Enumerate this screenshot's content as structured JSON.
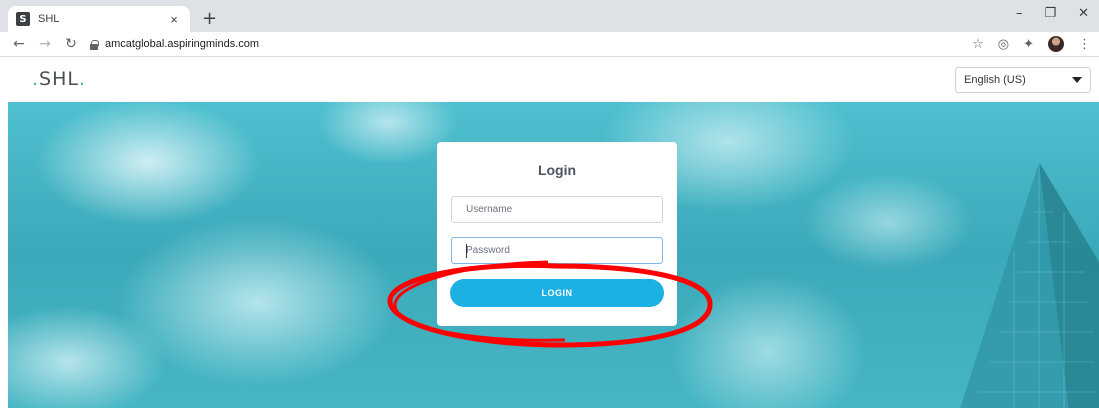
{
  "browser": {
    "tab_title": "SHL",
    "tab_favicon": "S",
    "tab_close": "×",
    "new_tab": "+",
    "url": "amcatglobal.aspiringminds.com",
    "window_controls": {
      "minimize": "–",
      "restore": "❐",
      "close": "✕"
    }
  },
  "site": {
    "logo_text": "SHL",
    "logo_dot_color": "#3eb3a4",
    "language_selected": "English (US)"
  },
  "login": {
    "title": "Login",
    "username_placeholder": "Username",
    "password_placeholder": "Password",
    "button_label": "LOGIN",
    "button_color": "#1db1e3"
  },
  "annotation": {
    "shape": "ellipse",
    "color": "#ff0000",
    "target": "login-button"
  }
}
